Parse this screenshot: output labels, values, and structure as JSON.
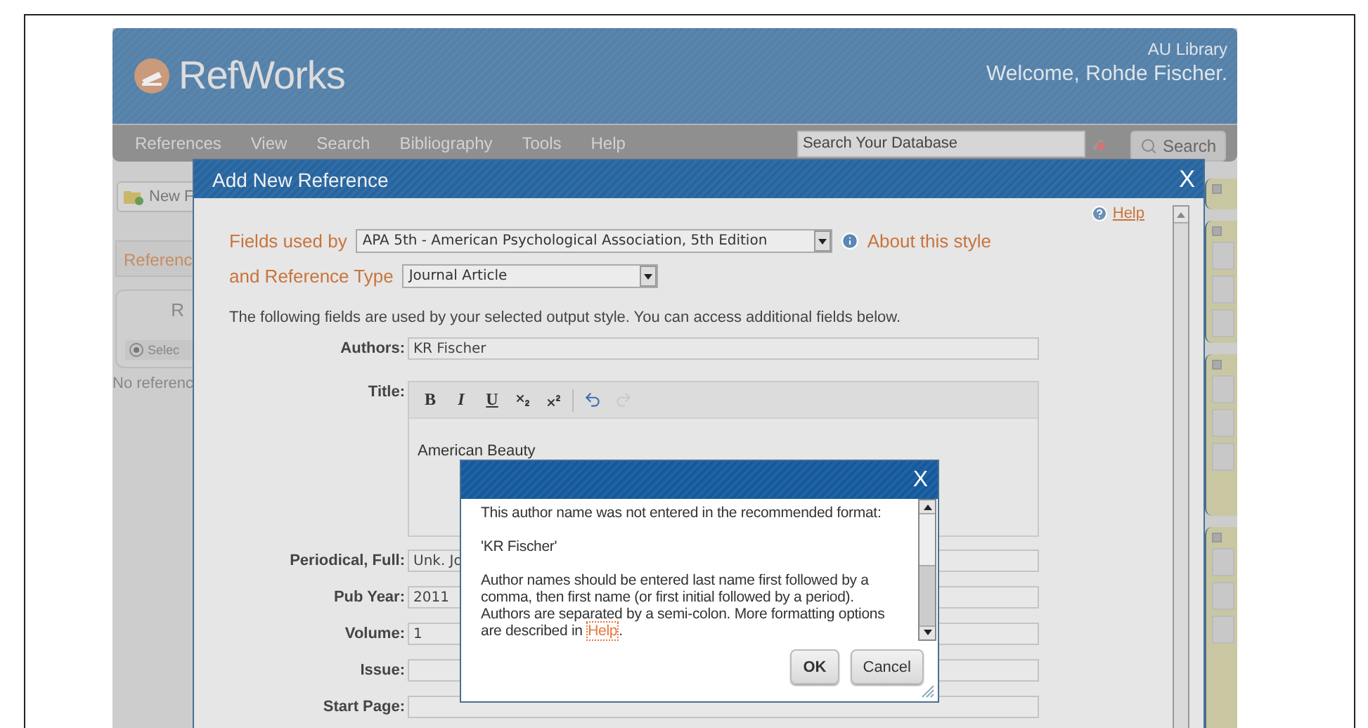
{
  "header": {
    "logo": "RefWorks",
    "institution": "AU Library",
    "welcome": "Welcome, Rohde Fischer."
  },
  "nav": {
    "items": [
      "References",
      "View",
      "Search",
      "Bibliography",
      "Tools",
      "Help"
    ],
    "search": {
      "placeholder": "Search Your Database"
    },
    "search_button": "Search"
  },
  "background": {
    "new_button": "New F",
    "tab": "Referenc",
    "panel_title": "R",
    "radio": {
      "label": "Selec",
      "selected": true
    },
    "empty_text": "No referenc"
  },
  "dialog": {
    "title": "Add New Reference",
    "close": "X",
    "help": "Help",
    "style_label": "Fields used by",
    "style": "APA 5th - American Psychological Association, 5th Edition",
    "about": "About this style",
    "type_label": "and Reference Type",
    "type": "Journal Article",
    "note": "The following fields are used by your selected output style. You can access additional fields below.",
    "toolbar": [
      {
        "kind": "bold",
        "label": "B"
      },
      {
        "kind": "italic",
        "label": "I"
      },
      {
        "kind": "underline",
        "label": "U"
      },
      {
        "kind": "subscript"
      },
      {
        "kind": "superscript"
      },
      {
        "kind": "undo",
        "disabled": false
      },
      {
        "kind": "redo",
        "disabled": true
      }
    ],
    "fields": [
      {
        "kind": "text",
        "label": "Authors:",
        "value": "KR Fischer"
      },
      {
        "kind": "editor",
        "label": "Title:",
        "value": "American Beauty"
      },
      {
        "kind": "text",
        "label": "Periodical, Full:",
        "value": "Unk. Jo"
      },
      {
        "kind": "text",
        "label": "Pub Year:",
        "value": "2011"
      },
      {
        "kind": "text",
        "label": "Volume:",
        "value": "1"
      },
      {
        "kind": "text",
        "label": "Issue:"
      },
      {
        "kind": "text",
        "label": "Start Page:"
      }
    ]
  },
  "alert": {
    "close": "X",
    "paragraphs": [
      "This author name was not entered in the recommended format:",
      "'KR Fischer'"
    ],
    "message": "Author names should be entered last name first followed by a comma, then first name (or first initial followed by a period). Authors are separated by a semi-colon. More formatting options are described in",
    "link": "Help",
    "link_suffix": ".",
    "buttons": [
      "OK",
      "Cancel"
    ]
  }
}
